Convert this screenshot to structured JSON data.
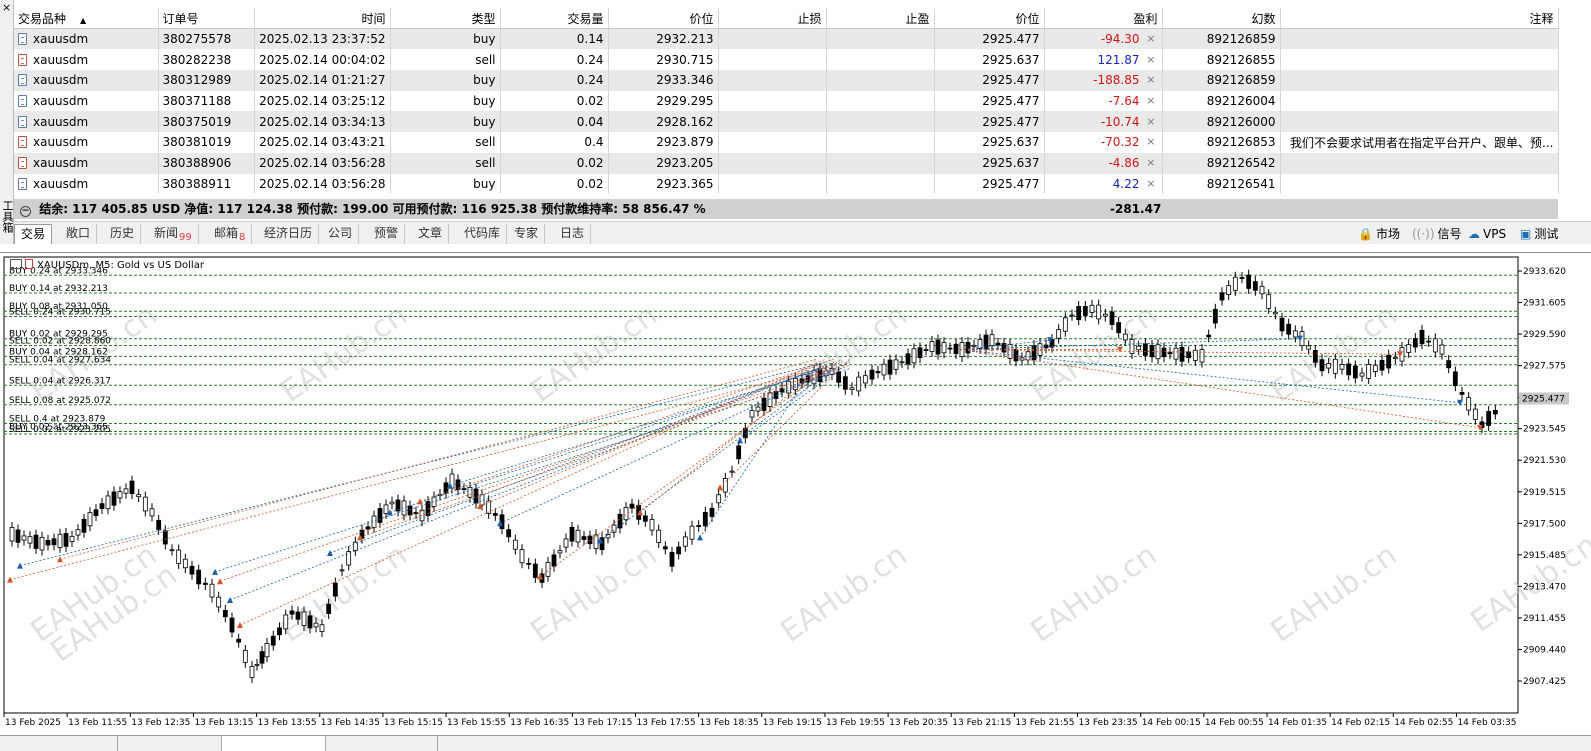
{
  "table": {
    "headers": [
      "交易品种",
      "订单号",
      "时间",
      "类型",
      "交易量",
      "价位",
      "止损",
      "止盈",
      "价位",
      "盈利",
      "幻数",
      "注释"
    ],
    "rows": [
      {
        "symbol": "xauusdm",
        "order": "380275578",
        "time": "2025.02.13 23:37:52",
        "type": "buy",
        "volume": "0.14",
        "price": "2932.213",
        "sl": "",
        "tp": "",
        "cur": "2925.477",
        "profit": "-94.30",
        "sign": "neg",
        "magic": "892126859",
        "comment": ""
      },
      {
        "symbol": "xauusdm",
        "order": "380282238",
        "time": "2025.02.14 00:04:02",
        "type": "sell",
        "volume": "0.24",
        "price": "2930.715",
        "sl": "",
        "tp": "",
        "cur": "2925.637",
        "profit": "121.87",
        "sign": "pos",
        "magic": "892126855",
        "comment": ""
      },
      {
        "symbol": "xauusdm",
        "order": "380312989",
        "time": "2025.02.14 01:21:27",
        "type": "buy",
        "volume": "0.24",
        "price": "2933.346",
        "sl": "",
        "tp": "",
        "cur": "2925.477",
        "profit": "-188.85",
        "sign": "neg",
        "magic": "892126859",
        "comment": ""
      },
      {
        "symbol": "xauusdm",
        "order": "380371188",
        "time": "2025.02.14 03:25:12",
        "type": "buy",
        "volume": "0.02",
        "price": "2929.295",
        "sl": "",
        "tp": "",
        "cur": "2925.477",
        "profit": "-7.64",
        "sign": "neg",
        "magic": "892126004",
        "comment": ""
      },
      {
        "symbol": "xauusdm",
        "order": "380375019",
        "time": "2025.02.14 03:34:13",
        "type": "buy",
        "volume": "0.04",
        "price": "2928.162",
        "sl": "",
        "tp": "",
        "cur": "2925.477",
        "profit": "-10.74",
        "sign": "neg",
        "magic": "892126000",
        "comment": ""
      },
      {
        "symbol": "xauusdm",
        "order": "380381019",
        "time": "2025.02.14 03:43:21",
        "type": "sell",
        "volume": "0.4",
        "price": "2923.879",
        "sl": "",
        "tp": "",
        "cur": "2925.637",
        "profit": "-70.32",
        "sign": "neg",
        "magic": "892126853",
        "comment": "我们不会要求试用者在指定平台开户、跟单、预..."
      },
      {
        "symbol": "xauusdm",
        "order": "380388906",
        "time": "2025.02.14 03:56:28",
        "type": "sell",
        "volume": "0.02",
        "price": "2923.205",
        "sl": "",
        "tp": "",
        "cur": "2925.637",
        "profit": "-4.86",
        "sign": "neg",
        "magic": "892126542",
        "comment": ""
      },
      {
        "symbol": "xauusdm",
        "order": "380388911",
        "time": "2025.02.14 03:56:28",
        "type": "buy",
        "volume": "0.02",
        "price": "2923.365",
        "sl": "",
        "tp": "",
        "cur": "2925.477",
        "profit": "4.22",
        "sign": "pos",
        "magic": "892126541",
        "comment": ""
      }
    ],
    "close_glyph": "×"
  },
  "summary": {
    "text": "结余: 117 405.85 USD  净值: 117 124.38  预付款: 199.00  可用预付款: 116 925.38  预付款维持率: 58 856.47 %",
    "total": "-281.47"
  },
  "side_tab": {
    "label": "工具箱",
    "close": "×"
  },
  "tabs": [
    {
      "label": "交易",
      "badge": "",
      "active": true
    },
    {
      "label": "敞口",
      "badge": ""
    },
    {
      "label": "历史",
      "badge": ""
    },
    {
      "label": "新闻",
      "badge": "99"
    },
    {
      "label": "邮箱",
      "badge": "8"
    },
    {
      "label": "经济日历",
      "badge": ""
    },
    {
      "label": "公司",
      "badge": ""
    },
    {
      "label": "预警",
      "badge": ""
    },
    {
      "label": "文章",
      "badge": ""
    },
    {
      "label": "代码库",
      "badge": ""
    },
    {
      "label": "专家",
      "badge": ""
    },
    {
      "label": "日志",
      "badge": ""
    }
  ],
  "right_tools": [
    {
      "label": "市场",
      "icon": "lock-icon"
    },
    {
      "label": "信号",
      "icon": "signal-icon"
    },
    {
      "label": "VPS",
      "icon": "cloud-icon"
    },
    {
      "label": "测试",
      "icon": "tester-icon"
    }
  ],
  "chart": {
    "header": "XAUUSDm, M5:  Gold vs US Dollar",
    "watermark": "EAHub.cn",
    "colors": {
      "grid": "#2e7d32",
      "buy": "#1c5fa8",
      "sell": "#d2552a"
    },
    "y_ticks": [
      "2933.620",
      "2931.605",
      "2929.590",
      "2927.575",
      "2925.545",
      "2923.545",
      "2921.530",
      "2919.515",
      "2917.500",
      "2915.485",
      "2913.470",
      "2911.455",
      "2909.440",
      "2907.425"
    ],
    "y_current": "2925.477",
    "x_ticks": [
      "13 Feb 2025",
      "13 Feb 11:55",
      "13 Feb 12:35",
      "13 Feb 13:15",
      "13 Feb 13:55",
      "13 Feb 14:35",
      "13 Feb 15:15",
      "13 Feb 15:55",
      "13 Feb 16:35",
      "13 Feb 17:15",
      "13 Feb 17:55",
      "13 Feb 18:35",
      "13 Feb 19:15",
      "13 Feb 19:55",
      "13 Feb 20:35",
      "13 Feb 21:15",
      "13 Feb 21:55",
      "13 Feb 23:35",
      "14 Feb 00:15",
      "14 Feb 00:55",
      "14 Feb 01:35",
      "14 Feb 02:15",
      "14 Feb 02:55",
      "14 Feb 03:35"
    ],
    "position_labels": [
      {
        "text": "BUY 0.24 at 2933.346",
        "price": 2933.346
      },
      {
        "text": "BUY 0.14 at 2932.213",
        "price": 2932.213
      },
      {
        "text": "BUY 0.08 at 2931.050",
        "price": 2931.05
      },
      {
        "text": "SELL 0.24 at 2930.715",
        "price": 2930.715
      },
      {
        "text": "BUY 0.02 at 2929.295",
        "price": 2929.295
      },
      {
        "text": "SELL 0.02 at 2928.860",
        "price": 2928.86
      },
      {
        "text": "BUY 0.04 at 2928.162",
        "price": 2928.162
      },
      {
        "text": "SELL 0.04 at 2927.634",
        "price": 2927.634
      },
      {
        "text": "SELL 0.04 at 2926.317",
        "price": 2926.317
      },
      {
        "text": "SELL 0.08 at 2925.072",
        "price": 2925.072
      },
      {
        "text": "SELL 0.4 at 2923.879",
        "price": 2923.879
      },
      {
        "text": "BUY 0.02 at 2923.365",
        "price": 2923.365
      },
      {
        "text": "SELL 0.02 at 2923.205",
        "price": 2923.205
      }
    ]
  }
}
